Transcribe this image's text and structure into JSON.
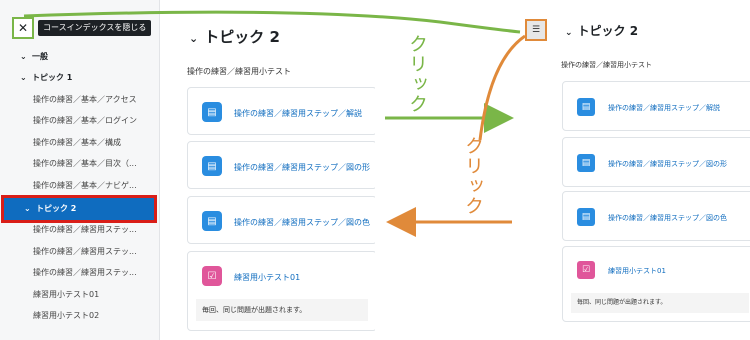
{
  "sidebar": {
    "close_tooltip": "コースインデックスを隠じる",
    "items": [
      {
        "label": "一般",
        "type": "section"
      },
      {
        "label": "トピック 1",
        "type": "section"
      },
      {
        "label": "操作の練習／基本／アクセス",
        "type": "item"
      },
      {
        "label": "操作の練習／基本／ログイン",
        "type": "item"
      },
      {
        "label": "操作の練習／基本／構成",
        "type": "item"
      },
      {
        "label": "操作の練習／基本／目次（...",
        "type": "item"
      },
      {
        "label": "操作の練習／基本／ナビゲ...",
        "type": "item"
      },
      {
        "label": "トピック 2",
        "type": "section",
        "active": true
      },
      {
        "label": "操作の練習／練習用ステッ...",
        "type": "item"
      },
      {
        "label": "操作の練習／練習用ステッ...",
        "type": "item"
      },
      {
        "label": "操作の練習／練習用ステッ...",
        "type": "item"
      },
      {
        "label": "練習用小テスト01",
        "type": "item"
      },
      {
        "label": "練習用小テスト02",
        "type": "item"
      }
    ]
  },
  "main": {
    "topic_title": "トピック 2",
    "summary": "操作の練習／練習用小テスト",
    "activities": [
      {
        "label": "操作の練習／練習用ステップ／解説",
        "icon": "page-icon",
        "color": "#2a8de0"
      },
      {
        "label": "操作の練習／練習用ステップ／図の形",
        "icon": "page-icon",
        "color": "#2a8de0"
      },
      {
        "label": "操作の練習／練習用ステップ／図の色",
        "icon": "page-icon",
        "color": "#2a8de0"
      },
      {
        "label": "練習用小テスト01",
        "icon": "quiz-icon",
        "color": "#e0569a",
        "description": "毎回、同じ問題が出題されます。"
      }
    ]
  },
  "right_panel": {
    "topic_title": "トピック 2",
    "summary": "操作の練習／練習用小テスト",
    "activities": [
      {
        "label": "操作の練習／練習用ステップ／解説"
      },
      {
        "label": "操作の練習／練習用ステップ／図の形"
      },
      {
        "label": "操作の練習／練習用ステップ／図の色"
      },
      {
        "label": "練習用小テスト01",
        "description": "毎回、同じ問題が出題されます。"
      }
    ]
  },
  "annotations": {
    "click_label": "クリック",
    "colors": {
      "green": "#7ab648",
      "orange": "#e08a3a",
      "highlight": "#d91e18"
    }
  }
}
